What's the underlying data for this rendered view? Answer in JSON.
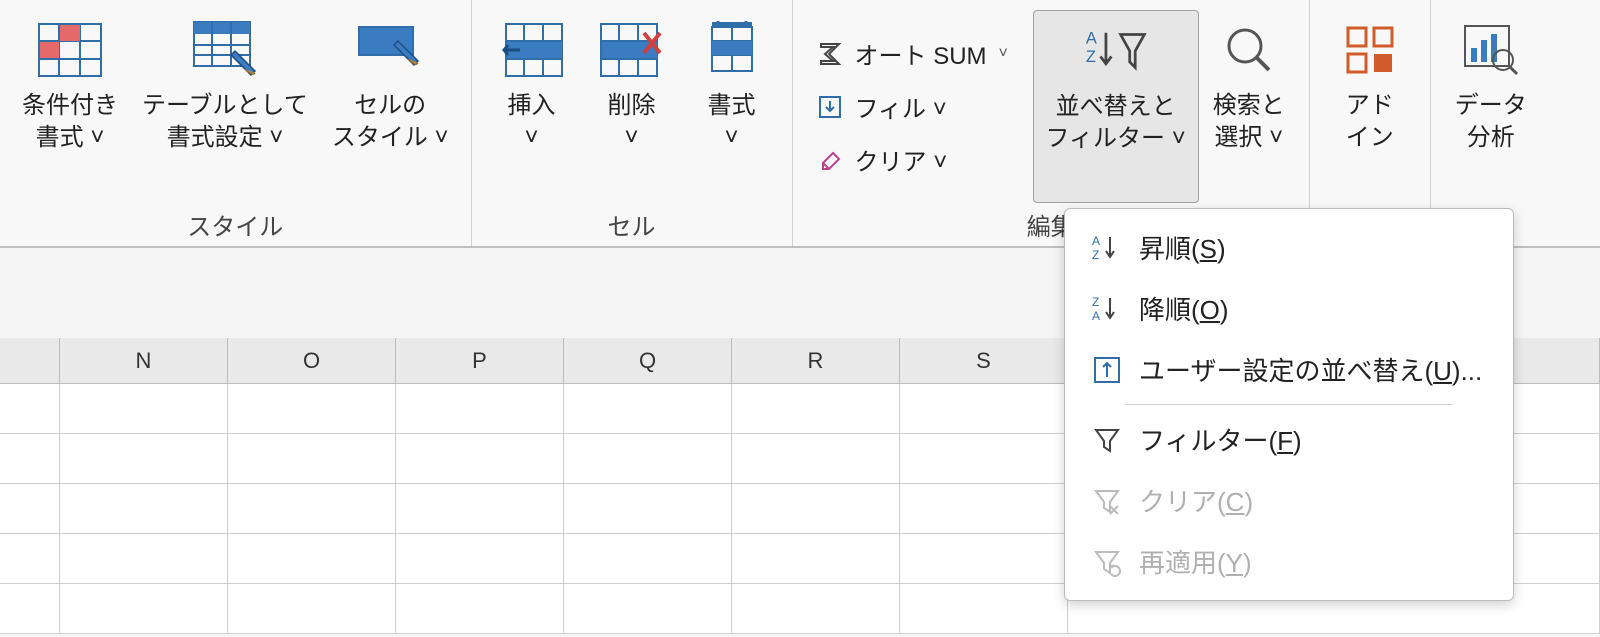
{
  "ribbon": {
    "styles": {
      "cond_format": "条件付き\n書式 ˅",
      "table_format": "テーブルとして\n書式設定 ˅",
      "cell_styles": "セルの\nスタイル ˅",
      "group_label": "スタイル"
    },
    "cells": {
      "insert": "挿入\n˅",
      "delete": "削除\n˅",
      "format": "書式\n˅",
      "group_label": "セル"
    },
    "editing": {
      "autosum": "オート SUM",
      "fill": "フィル ˅",
      "clear": "クリア ˅",
      "sort_filter": "並べ替えと\nフィルター ˅",
      "find_select": "検索と\n選択 ˅",
      "group_label": "編集"
    },
    "addins": {
      "label": "アド\nイン"
    },
    "analysis": {
      "label": "データ\n分析"
    }
  },
  "columns": [
    "N",
    "O",
    "P",
    "Q",
    "R",
    "S"
  ],
  "menu": {
    "asc": {
      "text": "昇順(",
      "accel": "S",
      "tail": ")"
    },
    "desc": {
      "text": "降順(",
      "accel": "O",
      "tail": ")"
    },
    "custom": {
      "text": "ユーザー設定の並べ替え(",
      "accel": "U",
      "tail": ")..."
    },
    "filter": {
      "text": "フィルター(",
      "accel": "F",
      "tail": ")"
    },
    "clear": {
      "text": "クリア(",
      "accel": "C",
      "tail": ")"
    },
    "reapply": {
      "text": "再適用(",
      "accel": "Y",
      "tail": ")"
    }
  }
}
